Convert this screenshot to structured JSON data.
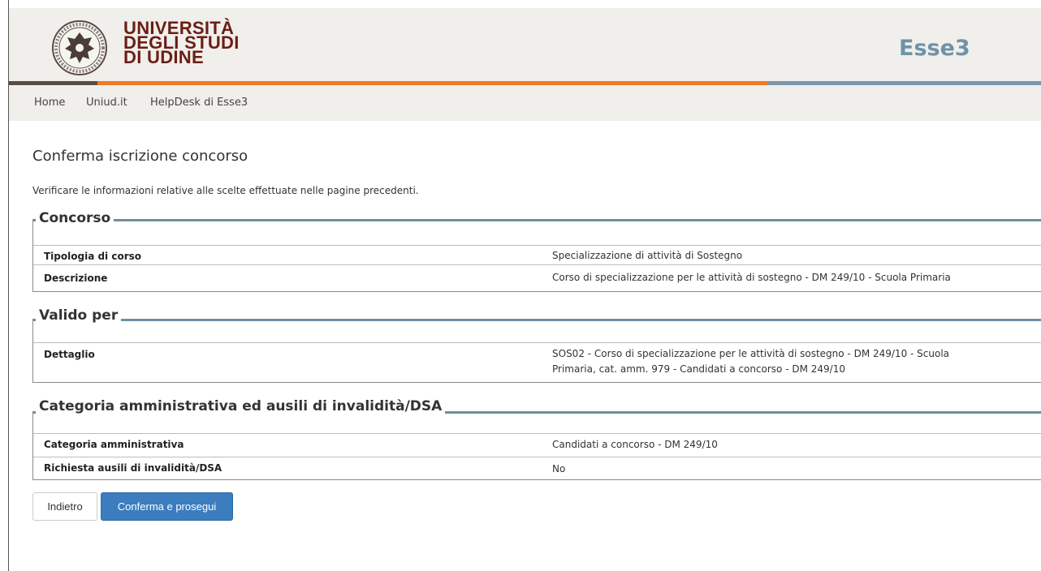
{
  "header": {
    "logo_lines": [
      "UNIVERSITÀ",
      "DEGLI STUDI",
      "DI UDINE"
    ],
    "app_name": "Esse3"
  },
  "nav": {
    "items": [
      {
        "label": "Home"
      },
      {
        "label": "Uniud.it"
      },
      {
        "label": "HelpDesk di Esse3"
      }
    ]
  },
  "page": {
    "title": "Conferma iscrizione concorso",
    "intro": "Verificare le informazioni relative alle scelte effettuate nelle pagine precedenti."
  },
  "sections": [
    {
      "legend": "Concorso",
      "rows": [
        {
          "key": "Tipologia di corso",
          "value": "Specializzazione di attività di Sostegno"
        },
        {
          "key": "Descrizione",
          "value": "Corso di specializzazione per le attività di sostegno - DM 249/10 - Scuola Primaria"
        }
      ]
    },
    {
      "legend": "Valido per",
      "rows": [
        {
          "key": "Dettaglio",
          "value_line1": "SOS02 - Corso di specializzazione per le attività di sostegno - DM 249/10 - Scuola",
          "value_line2": "Primaria, cat. amm. 979 - Candidati a concorso - DM 249/10"
        }
      ]
    },
    {
      "legend": "Categoria amministrativa ed ausili di invalidità/DSA",
      "rows": [
        {
          "key": "Categoria amministrativa",
          "value": "Candidati a concorso - DM 249/10"
        },
        {
          "key": "Richiesta ausili di invalidità/DSA",
          "value": "No"
        }
      ]
    }
  ],
  "buttons": {
    "back": "Indietro",
    "confirm": "Conferma e prosegui"
  },
  "colors": {
    "brand_text": "#6b1e14",
    "app_name": "#6f92a6",
    "stripe_dark": "#5a4b45",
    "stripe_orange": "#f07a22",
    "stripe_blue": "#7b98ab",
    "primary_button": "#3b7dbf"
  }
}
